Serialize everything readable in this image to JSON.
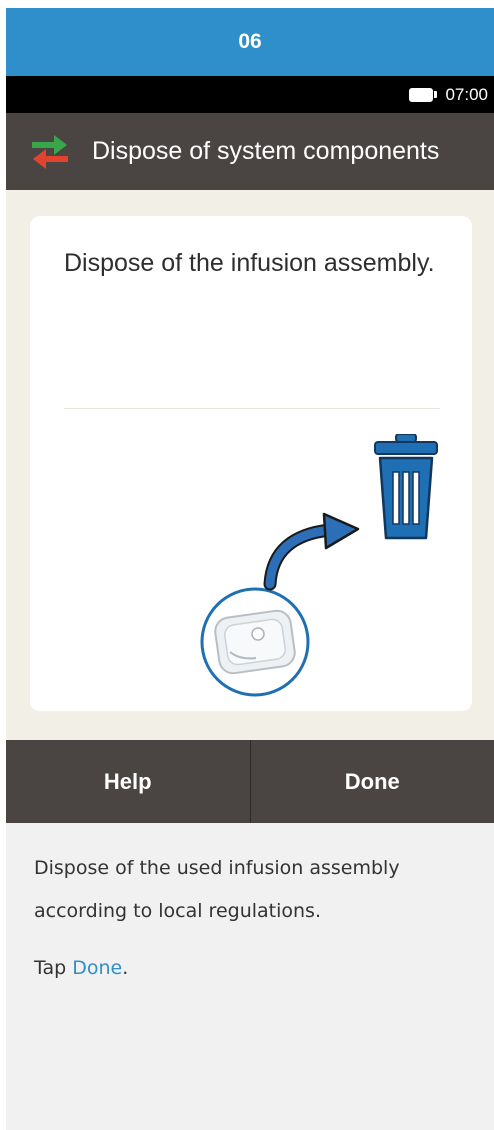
{
  "step": {
    "number": "06"
  },
  "status_bar": {
    "time": "07:00",
    "battery_icon": "battery-full-icon"
  },
  "title_bar": {
    "title": "Dispose of system components",
    "icon": "swap-arrows-icon"
  },
  "card": {
    "message": "Dispose of the infusion assembly.",
    "illustration_icons": [
      "infusion-assembly-icon",
      "curved-arrow-icon",
      "trash-can-icon"
    ]
  },
  "buttons": {
    "help": "Help",
    "done": "Done"
  },
  "instructions": {
    "paragraph1": "Dispose of the used infusion assembly according to local regulations.",
    "tap_prefix": "Tap ",
    "tap_link": "Done",
    "tap_suffix": "."
  },
  "colors": {
    "header_blue": "#2f8fca",
    "bar_dark": "#4a4543",
    "screen_bg": "#f2efe6",
    "trash_blue": "#1e6fb3",
    "arrow_green": "#3aa64a",
    "arrow_red": "#e2432f"
  }
}
